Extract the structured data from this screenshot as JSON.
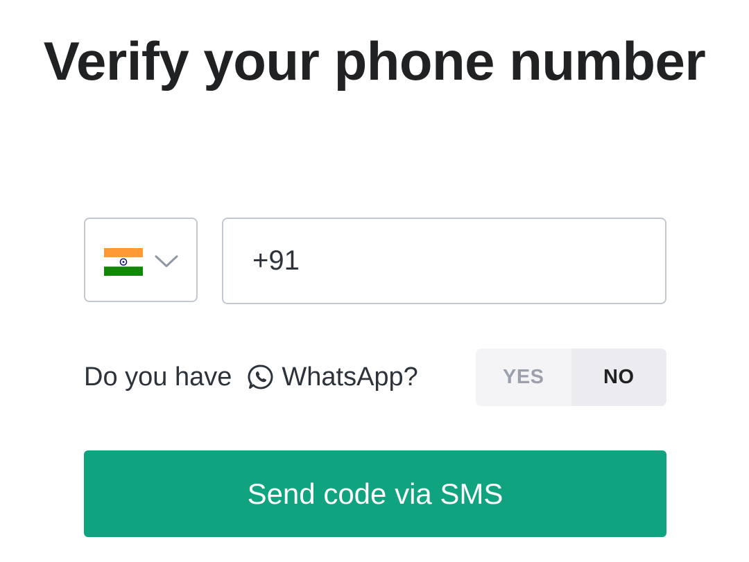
{
  "header": {
    "title": "Verify your phone number"
  },
  "country_select": {
    "flag_icon": "india-flag-icon",
    "chevron_icon": "chevron-down-icon"
  },
  "phone": {
    "value": "+91"
  },
  "whatsapp": {
    "prefix": "Do you have",
    "icon": "whatsapp-icon",
    "suffix": "WhatsApp?",
    "options": {
      "yes": "YES",
      "no": "NO"
    },
    "selected": "NO"
  },
  "actions": {
    "send_label": "Send code via SMS"
  },
  "colors": {
    "primary": "#10a37f",
    "text": "#202123",
    "border": "#c2c8d0",
    "toggle_bg": "#f4f4f6",
    "toggle_selected_bg": "#ececf0",
    "toggle_unselected_text": "#9ca0ad"
  }
}
